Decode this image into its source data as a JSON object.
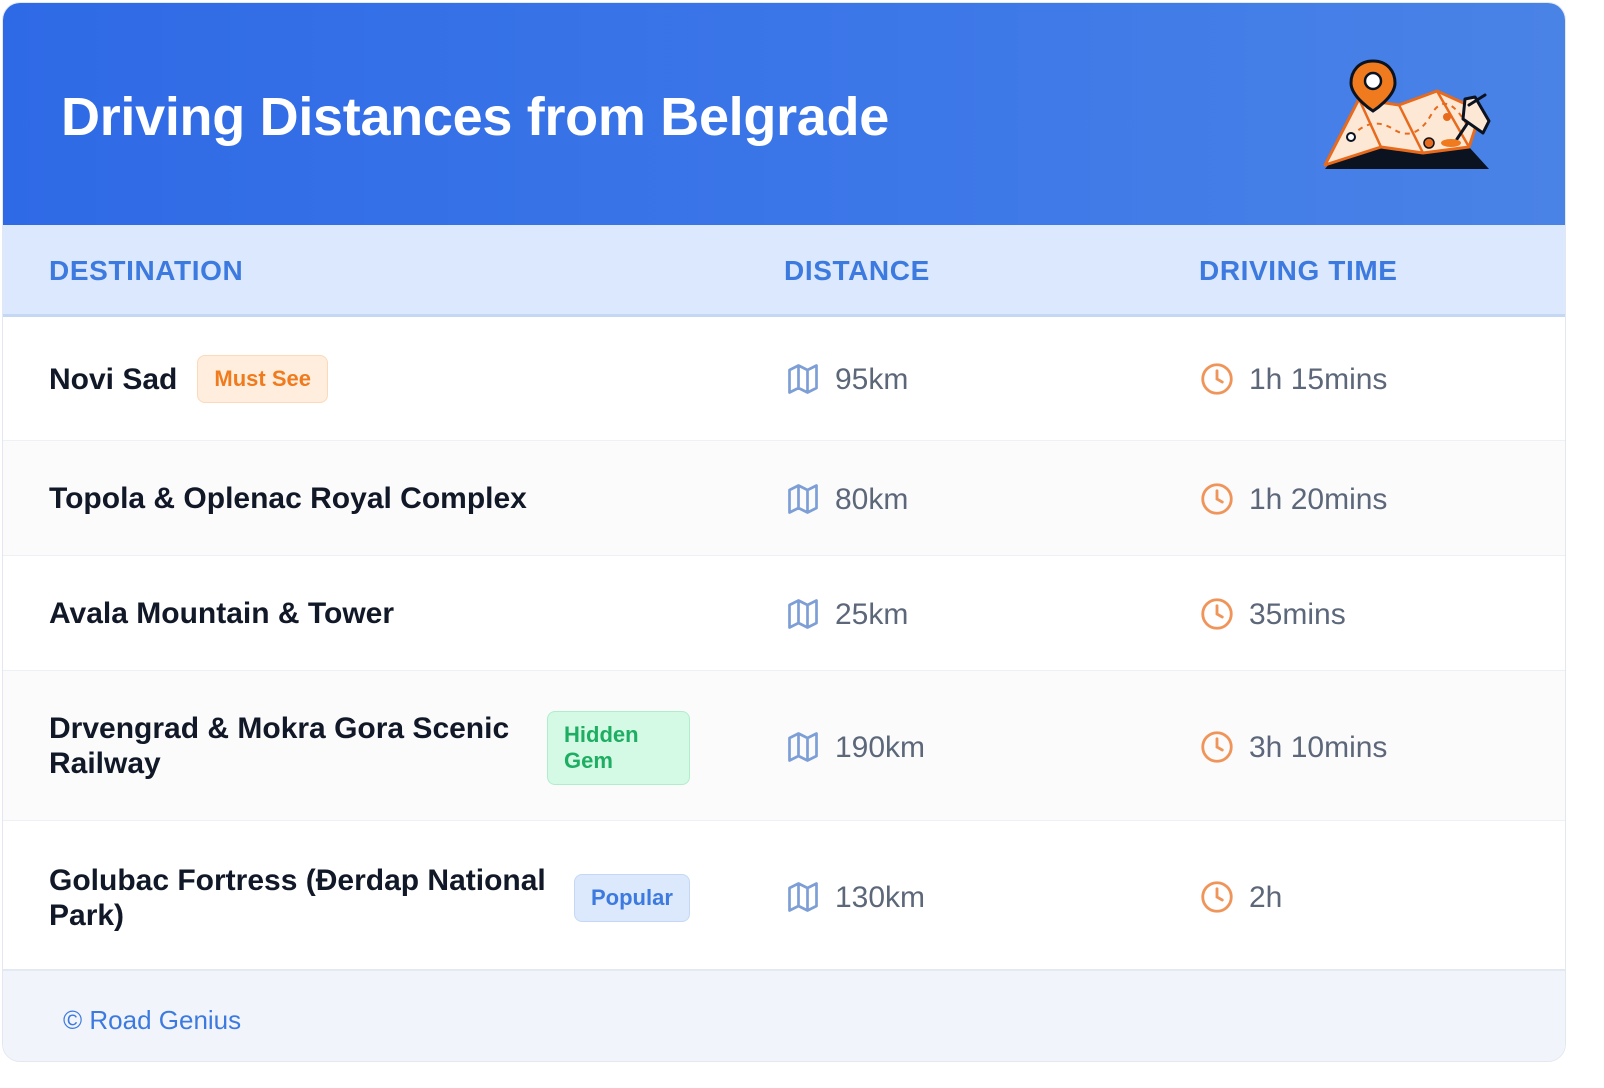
{
  "header": {
    "title": "Driving Distances from Belgrade",
    "icon": "map-with-pins-icon",
    "background": "#2f6ae6"
  },
  "table": {
    "columns": [
      "DESTINATION",
      "DISTANCE",
      "DRIVING TIME"
    ],
    "rows": [
      {
        "destination": "Novi Sad",
        "badge": "Must See",
        "distance": "95km",
        "time": "1h 15mins"
      },
      {
        "destination": "Topola & Oplenac Royal Complex",
        "badge": "",
        "distance": "80km",
        "time": "1h 20mins"
      },
      {
        "destination": "Avala Mountain & Tower",
        "badge": "",
        "distance": "25km",
        "time": "35mins"
      },
      {
        "destination_line1": "Drvengrad & Mokra Gora Scenic",
        "destination_line2": "Railway",
        "badge_line1": "Hidden",
        "badge_line2": "Gem",
        "distance": "190km",
        "time": "3h 10mins"
      },
      {
        "destination_line1": "Golubac Fortress (Đerdap National",
        "destination_line2": "Park)",
        "badge": "Popular",
        "distance": "130km",
        "time": "2h"
      }
    ]
  },
  "footer": {
    "text": "© Road Genius"
  },
  "colors": {
    "accent": "#3c7ae0",
    "must_see": "#f07b1e",
    "hidden_gem": "#1eae63",
    "clock": "#f0955a",
    "map": "#7e9fd6"
  }
}
